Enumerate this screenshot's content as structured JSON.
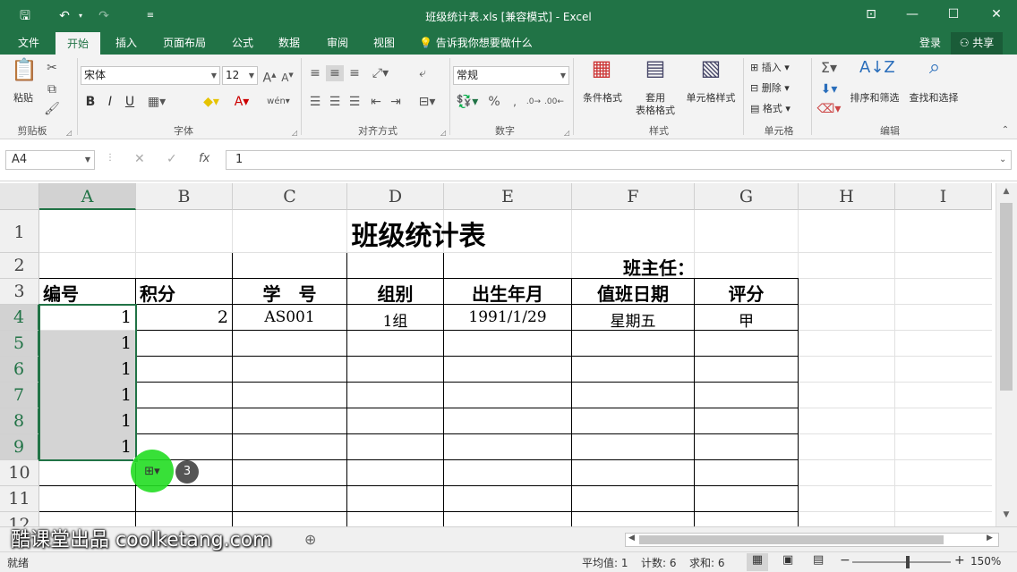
{
  "window": {
    "title": "班级统计表.xls  [兼容模式] - Excel"
  },
  "ribbon_tabs": [
    "文件",
    "开始",
    "插入",
    "页面布局",
    "公式",
    "数据",
    "审阅",
    "视图"
  ],
  "tell_me": "告诉我你想要做什么",
  "account": {
    "login": "登录",
    "share": "共享"
  },
  "clipboard": {
    "paste": "粘贴",
    "label": "剪贴板"
  },
  "font": {
    "name": "宋体",
    "size": "12",
    "label": "字体",
    "bold": "B",
    "italic": "I",
    "underline": "U"
  },
  "alignment": {
    "label": "对齐方式"
  },
  "number": {
    "format": "常规",
    "label": "数字",
    "percent": "%"
  },
  "styles": {
    "conditional": "条件格式",
    "table_a": "套用",
    "table_b": "表格格式",
    "cell_styles": "单元格样式",
    "label": "样式"
  },
  "cells": {
    "insert": "插入",
    "delete": "删除",
    "format": "格式",
    "label": "单元格"
  },
  "editing": {
    "sort": "排序和筛选",
    "find": "查找和选择",
    "label": "编辑"
  },
  "formula_bar": {
    "name_box": "A4",
    "value": "1",
    "fx": "fx"
  },
  "columns": [
    "A",
    "B",
    "C",
    "D",
    "E",
    "F",
    "G",
    "H",
    "I"
  ],
  "rows": [
    "1",
    "2",
    "3",
    "4",
    "5",
    "6",
    "7",
    "8",
    "9",
    "10",
    "11",
    "12"
  ],
  "sheet": {
    "title": "班级统计表",
    "head_teacher": "班主任：",
    "headers": [
      "编号",
      "积分",
      "学　号",
      "组别",
      "出生年月",
      "值班日期",
      "评分"
    ],
    "row4": [
      "1",
      "2",
      "AS001",
      "1组",
      "1991/1/29",
      "星期五",
      "甲"
    ],
    "filled": [
      "1",
      "1",
      "1",
      "1",
      "1"
    ]
  },
  "autofill": {
    "badge": "3"
  },
  "watermark": "酷课堂出品 coolketang.com",
  "status": {
    "ready": "就绪",
    "average": "平均值: 1",
    "count": "计数: 6",
    "sum": "求和: 6",
    "zoom": "150%"
  },
  "colors": {
    "accent": "#217346",
    "selection_fill": "#d4d4d4",
    "autofill_highlight": "#22dd22"
  }
}
